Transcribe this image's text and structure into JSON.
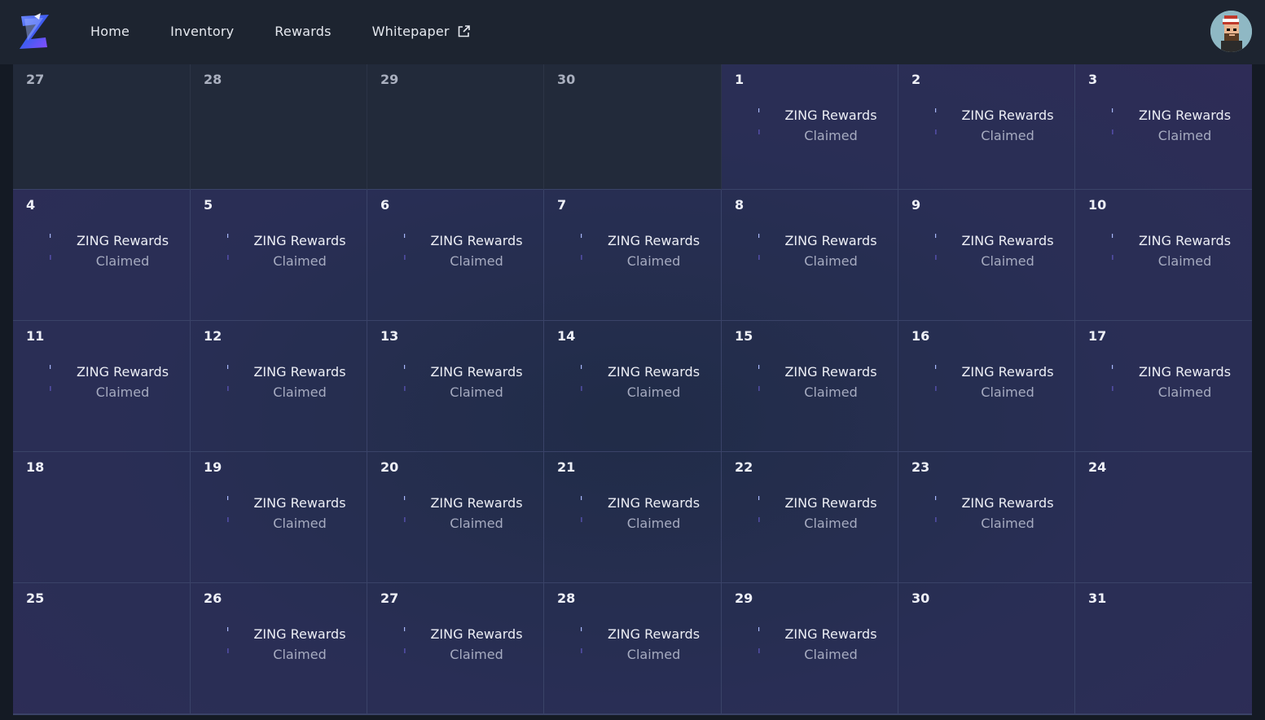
{
  "nav": {
    "items": [
      {
        "label": "Home"
      },
      {
        "label": "Inventory"
      },
      {
        "label": "Rewards"
      },
      {
        "label": "Whitepaper",
        "external": true
      }
    ]
  },
  "colors": {
    "topbar": "#1d2430",
    "accent_logo": "#4a6cff",
    "cell_border": "#3a4368"
  },
  "calendar": {
    "reward_title": "ZING Rewards",
    "reward_status": "Claimed",
    "days": [
      {
        "num": "27",
        "outside": true,
        "claimed": false
      },
      {
        "num": "28",
        "outside": true,
        "claimed": false
      },
      {
        "num": "29",
        "outside": true,
        "claimed": false
      },
      {
        "num": "30",
        "outside": true,
        "claimed": false
      },
      {
        "num": "1",
        "outside": false,
        "claimed": true
      },
      {
        "num": "2",
        "outside": false,
        "claimed": true
      },
      {
        "num": "3",
        "outside": false,
        "claimed": true
      },
      {
        "num": "4",
        "outside": false,
        "claimed": true
      },
      {
        "num": "5",
        "outside": false,
        "claimed": true
      },
      {
        "num": "6",
        "outside": false,
        "claimed": true
      },
      {
        "num": "7",
        "outside": false,
        "claimed": true
      },
      {
        "num": "8",
        "outside": false,
        "claimed": true
      },
      {
        "num": "9",
        "outside": false,
        "claimed": true
      },
      {
        "num": "10",
        "outside": false,
        "claimed": true
      },
      {
        "num": "11",
        "outside": false,
        "claimed": true
      },
      {
        "num": "12",
        "outside": false,
        "claimed": true
      },
      {
        "num": "13",
        "outside": false,
        "claimed": true
      },
      {
        "num": "14",
        "outside": false,
        "claimed": true
      },
      {
        "num": "15",
        "outside": false,
        "claimed": true
      },
      {
        "num": "16",
        "outside": false,
        "claimed": true
      },
      {
        "num": "17",
        "outside": false,
        "claimed": true
      },
      {
        "num": "18",
        "outside": false,
        "claimed": false
      },
      {
        "num": "19",
        "outside": false,
        "claimed": true
      },
      {
        "num": "20",
        "outside": false,
        "claimed": true
      },
      {
        "num": "21",
        "outside": false,
        "claimed": true
      },
      {
        "num": "22",
        "outside": false,
        "claimed": true
      },
      {
        "num": "23",
        "outside": false,
        "claimed": true
      },
      {
        "num": "24",
        "outside": false,
        "claimed": false
      },
      {
        "num": "25",
        "outside": false,
        "claimed": false
      },
      {
        "num": "26",
        "outside": false,
        "claimed": true
      },
      {
        "num": "27",
        "outside": false,
        "claimed": true
      },
      {
        "num": "28",
        "outside": false,
        "claimed": true
      },
      {
        "num": "29",
        "outside": false,
        "claimed": true
      },
      {
        "num": "30",
        "outside": false,
        "claimed": false
      },
      {
        "num": "31",
        "outside": false,
        "claimed": false
      }
    ]
  }
}
